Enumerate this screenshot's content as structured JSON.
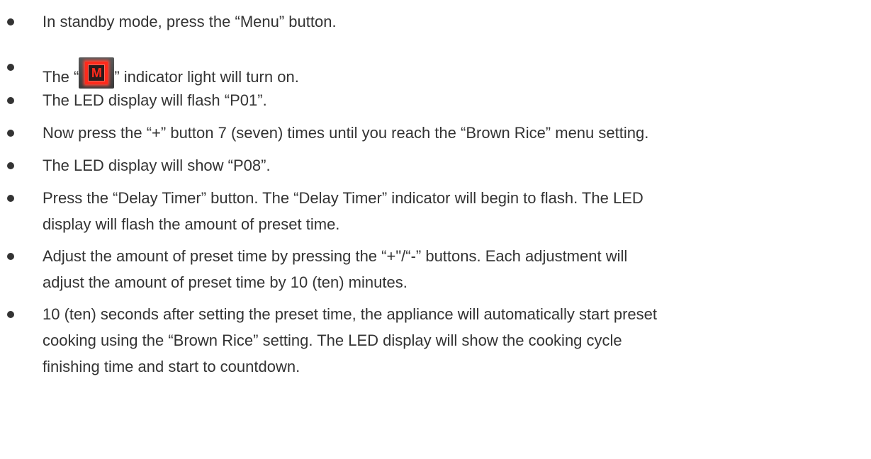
{
  "instructions": [
    {
      "lines": [
        "In standby mode, press the “Menu” button."
      ]
    },
    {
      "before": "The “",
      "after": "” indicator light will turn on.",
      "indicator": {
        "icon": "menu-m-indicator-icon",
        "glyph": "M",
        "color": "#ff2a1c"
      }
    },
    {
      "lines": [
        "The LED display will flash “P01”."
      ]
    },
    {
      "lines": [
        "Now press the “+” button 7 (seven) times until you reach the “Brown Rice” menu setting."
      ]
    },
    {
      "lines": [
        "The LED display will show “P08”."
      ]
    },
    {
      "lines": [
        "Press the “Delay Timer” button.  The “Delay Timer” indicator will begin to flash.  The LED",
        "display will flash the amount of preset time."
      ]
    },
    {
      "lines": [
        "Adjust the amount of preset time by pressing the “+\"/“-” buttons.  Each adjustment will",
        "adjust the amount of preset time by 10 (ten) minutes."
      ]
    },
    {
      "lines": [
        "10 (ten) seconds after setting the preset time, the appliance will automatically start preset",
        "cooking using the “Brown Rice” setting.  The LED display will show the cooking cycle",
        "finishing time and start to countdown."
      ]
    }
  ]
}
